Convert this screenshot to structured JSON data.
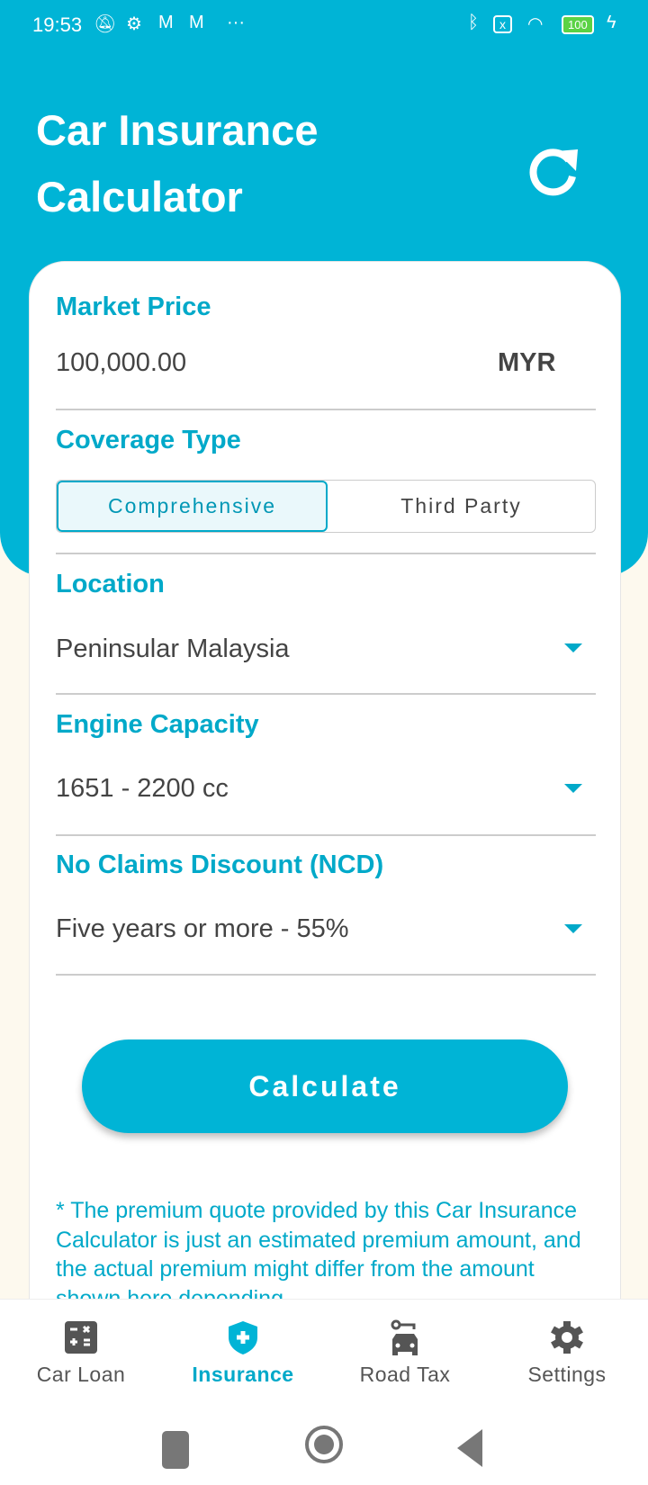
{
  "status_bar": {
    "time": "19:53",
    "battery": "100",
    "more": "···"
  },
  "header": {
    "title_line1": "Car Insurance",
    "title_line2": "Calculator"
  },
  "form": {
    "market_price": {
      "label": "Market Price",
      "value": "100,000.00",
      "currency": "MYR"
    },
    "coverage": {
      "label": "Coverage Type",
      "options": [
        "Comprehensive",
        "Third Party"
      ],
      "selected": "Comprehensive"
    },
    "location": {
      "label": "Location",
      "value": "Peninsular Malaysia"
    },
    "engine": {
      "label": "Engine Capacity",
      "value": "1651 - 2200 cc"
    },
    "ncd": {
      "label": "No Claims Discount (NCD)",
      "value": "Five years or more - 55%"
    },
    "calculate_label": "Calculate",
    "disclaimer": "* The premium quote provided by this Car Insurance Calculator is just an estimated premium amount, and the actual premium might differ from the amount shown here depending"
  },
  "bottom_nav": {
    "items": [
      {
        "label": "Car Loan",
        "icon": "calculator-icon"
      },
      {
        "label": "Insurance",
        "icon": "shield-plus-icon",
        "active": true
      },
      {
        "label": "Road Tax",
        "icon": "car-key-icon"
      },
      {
        "label": "Settings",
        "icon": "gear-icon"
      }
    ]
  },
  "colors": {
    "accent": "#00b4d6",
    "background": "#fdf9ee"
  }
}
